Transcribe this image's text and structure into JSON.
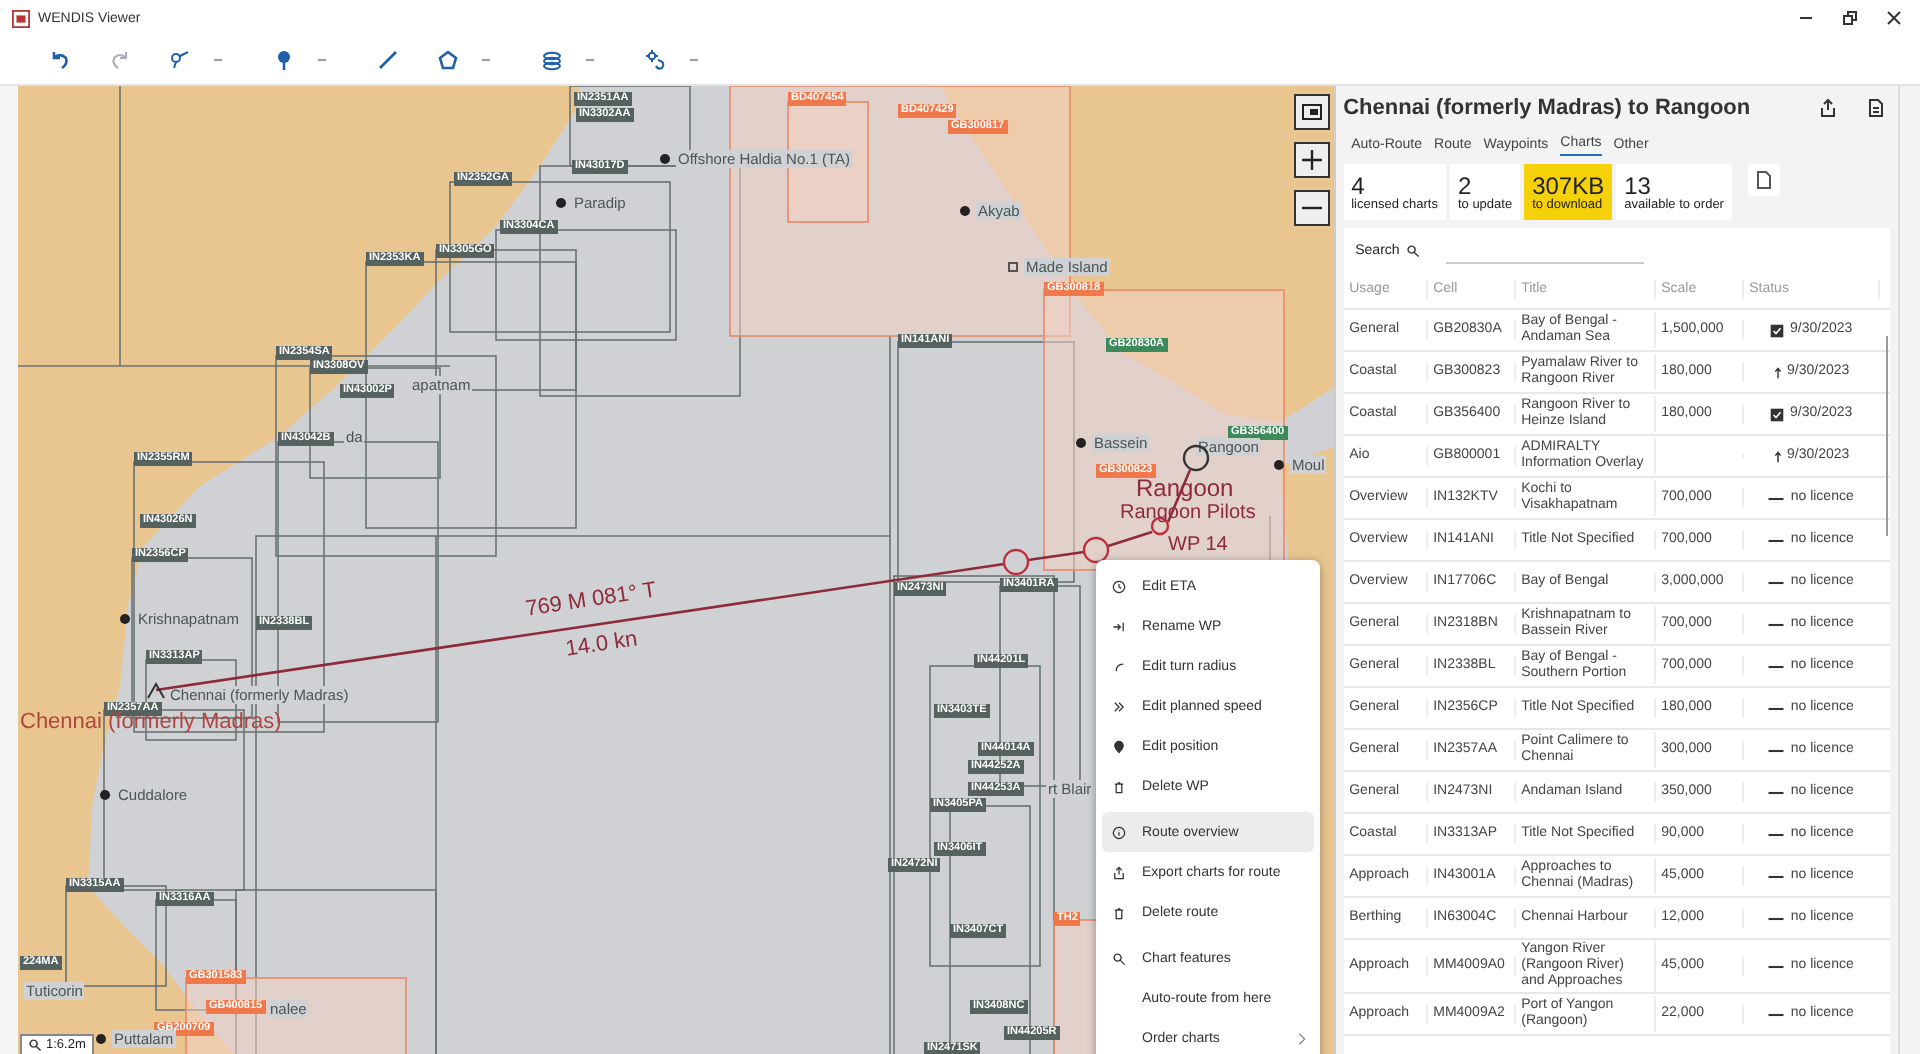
{
  "window": {
    "title": "WENDIS Viewer"
  },
  "map": {
    "chart_labels": [
      {
        "text": "IN2351AA",
        "color": "#55625f"
      },
      {
        "text": "IN3302AA",
        "color": "#55625f"
      },
      {
        "text": "IN43017D",
        "color": "#55625f"
      },
      {
        "text": "IN2352GA",
        "color": "#55625f"
      },
      {
        "text": "IN3304CA",
        "color": "#55625f"
      },
      {
        "text": "IN3305GO",
        "color": "#55625f"
      },
      {
        "text": "IN2353KA",
        "color": "#55625f"
      },
      {
        "text": "IN2354SA",
        "color": "#55625f"
      },
      {
        "text": "IN3308OV",
        "color": "#55625f"
      },
      {
        "text": "IN43002P",
        "color": "#55625f"
      },
      {
        "text": "IN43042B",
        "color": "#55625f"
      },
      {
        "text": "IN2355RM",
        "color": "#55625f"
      },
      {
        "text": "IN43026N",
        "color": "#55625f"
      },
      {
        "text": "IN2356CP",
        "color": "#55625f"
      },
      {
        "text": "IN2338BL",
        "color": "#55625f"
      },
      {
        "text": "IN3313AP",
        "color": "#55625f"
      },
      {
        "text": "IN2357AA",
        "color": "#55625f"
      },
      {
        "text": "IN3315AA",
        "color": "#55625f"
      },
      {
        "text": "IN3316AA",
        "color": "#55625f"
      },
      {
        "text": "224MA",
        "color": "#55625f"
      },
      {
        "text": "IN141ANI",
        "color": "#55625f"
      },
      {
        "text": "IN2473NI",
        "color": "#55625f"
      },
      {
        "text": "IN3401RA",
        "color": "#55625f"
      },
      {
        "text": "IN44201L",
        "color": "#55625f"
      },
      {
        "text": "IN3403TE",
        "color": "#55625f"
      },
      {
        "text": "IN44014A",
        "color": "#55625f"
      },
      {
        "text": "IN44252A",
        "color": "#55625f"
      },
      {
        "text": "IN44253A",
        "color": "#55625f"
      },
      {
        "text": "IN3405PA",
        "color": "#55625f"
      },
      {
        "text": "IN3406IT",
        "color": "#55625f"
      },
      {
        "text": "IN2472NI",
        "color": "#55625f"
      },
      {
        "text": "IN3407CT",
        "color": "#55625f"
      },
      {
        "text": "IN3408NC",
        "color": "#55625f"
      },
      {
        "text": "IN44205R",
        "color": "#55625f"
      },
      {
        "text": "IN2471SK",
        "color": "#55625f"
      },
      {
        "text": "GB20830A",
        "color": "#3d8a5c"
      },
      {
        "text": "GB356400",
        "color": "#3d8a5c"
      },
      {
        "text": "BD407454",
        "color": "#f0784a"
      },
      {
        "text": "BD407429",
        "color": "#f0784a"
      },
      {
        "text": "GB300817",
        "color": "#f0784a"
      },
      {
        "text": "GB300818",
        "color": "#f0784a"
      },
      {
        "text": "GB300823",
        "color": "#f0784a"
      },
      {
        "text": "GB301583",
        "color": "#f0784a"
      },
      {
        "text": "GB400815",
        "color": "#f0784a"
      },
      {
        "text": "GB200709",
        "color": "#f0784a"
      },
      {
        "text": "TH2",
        "color": "#f0784a"
      }
    ],
    "places": [
      "Offshore Haldia No.1 (TA)",
      "Paradip",
      "Akyab",
      "Made Island",
      "Bassein",
      "Rangoon",
      "Moul",
      "apatnam",
      "da",
      "Krishnapatnam",
      "Chennai (formerly Madras)",
      "Cuddalore",
      "Tuticorin",
      "nalee",
      "Puttalam",
      "rt Blair"
    ],
    "route": {
      "distance_bearing": "769 M 081° T",
      "speed": "14.0 kn",
      "start": "Chennai (formerly Madras)",
      "destination": "Rangoon",
      "pilots": "Rangoon Pilots",
      "waypoint": "WP 14"
    },
    "scale": "1:6.2m"
  },
  "context_menu": [
    {
      "label": "Edit ETA",
      "selected": false,
      "submenu": false
    },
    {
      "label": "Rename WP",
      "selected": false,
      "submenu": false
    },
    {
      "label": "Edit turn radius",
      "selected": false,
      "submenu": false
    },
    {
      "label": "Edit planned speed",
      "selected": false,
      "submenu": false
    },
    {
      "label": "Edit position",
      "selected": false,
      "submenu": false
    },
    {
      "label": "Delete WP",
      "selected": false,
      "submenu": false
    },
    {
      "label": "Route overview",
      "selected": true,
      "submenu": false
    },
    {
      "label": "Export charts for route",
      "selected": false,
      "submenu": false
    },
    {
      "label": "Delete route",
      "selected": false,
      "submenu": false
    },
    {
      "label": "Chart features",
      "selected": false,
      "submenu": false
    },
    {
      "label": "Auto-route from here",
      "selected": false,
      "submenu": false
    },
    {
      "label": "Order charts",
      "selected": false,
      "submenu": true
    }
  ],
  "panel": {
    "title": "Chennai (formerly Madras) to Rangoon",
    "tabs": [
      {
        "label": "Auto-Route",
        "selected": false
      },
      {
        "label": "Route",
        "selected": false
      },
      {
        "label": "Waypoints",
        "selected": false
      },
      {
        "label": "Charts",
        "selected": true
      },
      {
        "label": "Other",
        "selected": false
      }
    ],
    "stats": [
      {
        "value": "4",
        "label": "licensed charts",
        "highlighted": false
      },
      {
        "value": "2",
        "label": "to update",
        "highlighted": false
      },
      {
        "value": "307KB",
        "label": "to download",
        "highlighted": true
      },
      {
        "value": "13",
        "label": "available to order",
        "highlighted": false
      }
    ],
    "search_label": "Search",
    "columns": [
      "Usage",
      "Cell",
      "Title",
      "Scale",
      "Status"
    ],
    "rows": [
      {
        "usage": "General",
        "cell": "GB20830A",
        "title": "Bay of Bengal - Andaman Sea",
        "scale": "1,500,000",
        "kind": "licensed",
        "status_text": "9/30/2023"
      },
      {
        "usage": "Coastal",
        "cell": "GB300823",
        "title": "Pyamalaw River to Rangoon River",
        "scale": "180,000",
        "kind": "update",
        "status_text": "9/30/2023"
      },
      {
        "usage": "Coastal",
        "cell": "GB356400",
        "title": "Rangoon River to Heinze Island",
        "scale": "180,000",
        "kind": "licensed",
        "status_text": "9/30/2023"
      },
      {
        "usage": "Aio",
        "cell": "GB800001",
        "title": "ADMIRALTY Information Overlay",
        "kind": "update",
        "status_text": "9/30/2023"
      },
      {
        "usage": "Overview",
        "cell": "IN132KTV",
        "title": "Kochi to Visakhapatnam",
        "scale": "700,000",
        "kind": "none",
        "status_text": "no licence"
      },
      {
        "usage": "Overview",
        "cell": "IN141ANI",
        "title": "Title Not Specified",
        "scale": "700,000",
        "kind": "none",
        "status_text": "no licence"
      },
      {
        "usage": "Overview",
        "cell": "IN17706C",
        "title": "Bay of Bengal",
        "scale": "3,000,000",
        "kind": "none",
        "status_text": "no licence"
      },
      {
        "usage": "General",
        "cell": "IN2318BN",
        "title": "Krishnapatnam to Bassein River",
        "scale": "700,000",
        "kind": "none",
        "status_text": "no licence"
      },
      {
        "usage": "General",
        "cell": "IN2338BL",
        "title": "Bay of Bengal - Southern Portion",
        "scale": "700,000",
        "kind": "none",
        "status_text": "no licence"
      },
      {
        "usage": "General",
        "cell": "IN2356CP",
        "title": "Title Not Specified",
        "scale": "180,000",
        "kind": "none",
        "status_text": "no licence"
      },
      {
        "usage": "General",
        "cell": "IN2357AA",
        "title": "Point Calimere to Chennai",
        "scale": "300,000",
        "kind": "none",
        "status_text": "no licence"
      },
      {
        "usage": "General",
        "cell": "IN2473NI",
        "title": "Andaman Island",
        "scale": "350,000",
        "kind": "none",
        "status_text": "no licence"
      },
      {
        "usage": "Coastal",
        "cell": "IN3313AP",
        "title": "Title Not Specified",
        "scale": "90,000",
        "kind": "none",
        "status_text": "no licence"
      },
      {
        "usage": "Approach",
        "cell": "IN43001A",
        "title": "Approaches to Chennai (Madras)",
        "scale": "45,000",
        "kind": "none",
        "status_text": "no licence"
      },
      {
        "usage": "Berthing",
        "cell": "IN63004C",
        "title": "Chennai Harbour",
        "scale": "12,000",
        "kind": "none",
        "status_text": "no licence"
      },
      {
        "usage": "Approach",
        "cell": "MM4009A0",
        "title": "Yangon River (Rangoon River) and Approaches",
        "scale": "45,000",
        "kind": "none",
        "status_text": "no licence"
      },
      {
        "usage": "Approach",
        "cell": "MM4009A2",
        "title": "Port of Yangon (Rangoon)",
        "scale": "22,000",
        "kind": "none",
        "status_text": "no licence"
      }
    ]
  }
}
